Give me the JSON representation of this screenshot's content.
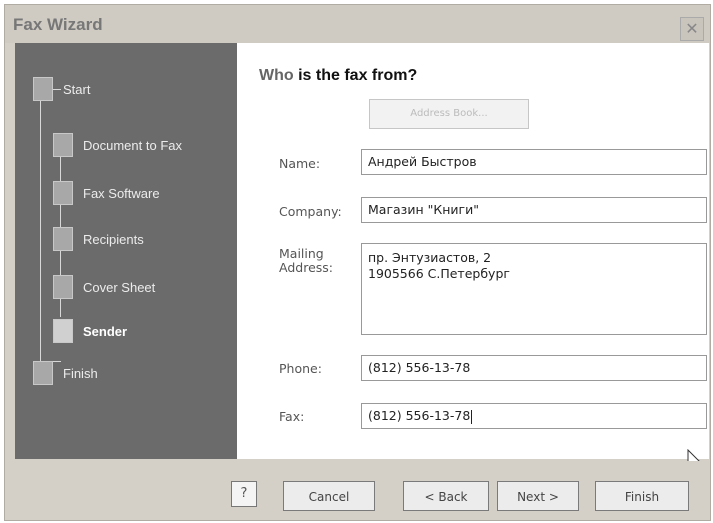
{
  "window": {
    "title": "Fax Wizard",
    "close_glyph": "✕"
  },
  "steps": [
    {
      "label": "Start"
    },
    {
      "label": "Document to Fax"
    },
    {
      "label": "Fax Software"
    },
    {
      "label": "Recipients"
    },
    {
      "label": "Cover Sheet"
    },
    {
      "label": "Sender"
    },
    {
      "label": "Finish"
    }
  ],
  "active_step": "Sender",
  "main": {
    "heading_who": "Who",
    "heading_rest": "is the fax from?",
    "address_book_label": "Address Book...",
    "fields": {
      "name": {
        "label": "Name:",
        "value": "Андрей Быстров"
      },
      "company": {
        "label": "Company:",
        "value": "Магазин \"Книги\""
      },
      "mailing": {
        "label": "Mailing\nAddress:",
        "value": "пр. Энтузиастов, 2\n1905566 С.Петербург"
      },
      "phone": {
        "label": "Phone:",
        "value": "(812) 556-13-78"
      },
      "fax": {
        "label": "Fax:",
        "value": "(812) 556-13-78"
      }
    }
  },
  "footer": {
    "help": "?",
    "cancel": "Cancel",
    "back": "< Back",
    "next": "Next >",
    "finish": "Finish"
  },
  "icons": {
    "help": "help-icon",
    "close": "close-icon",
    "cursor": "mouse-cursor-icon"
  }
}
